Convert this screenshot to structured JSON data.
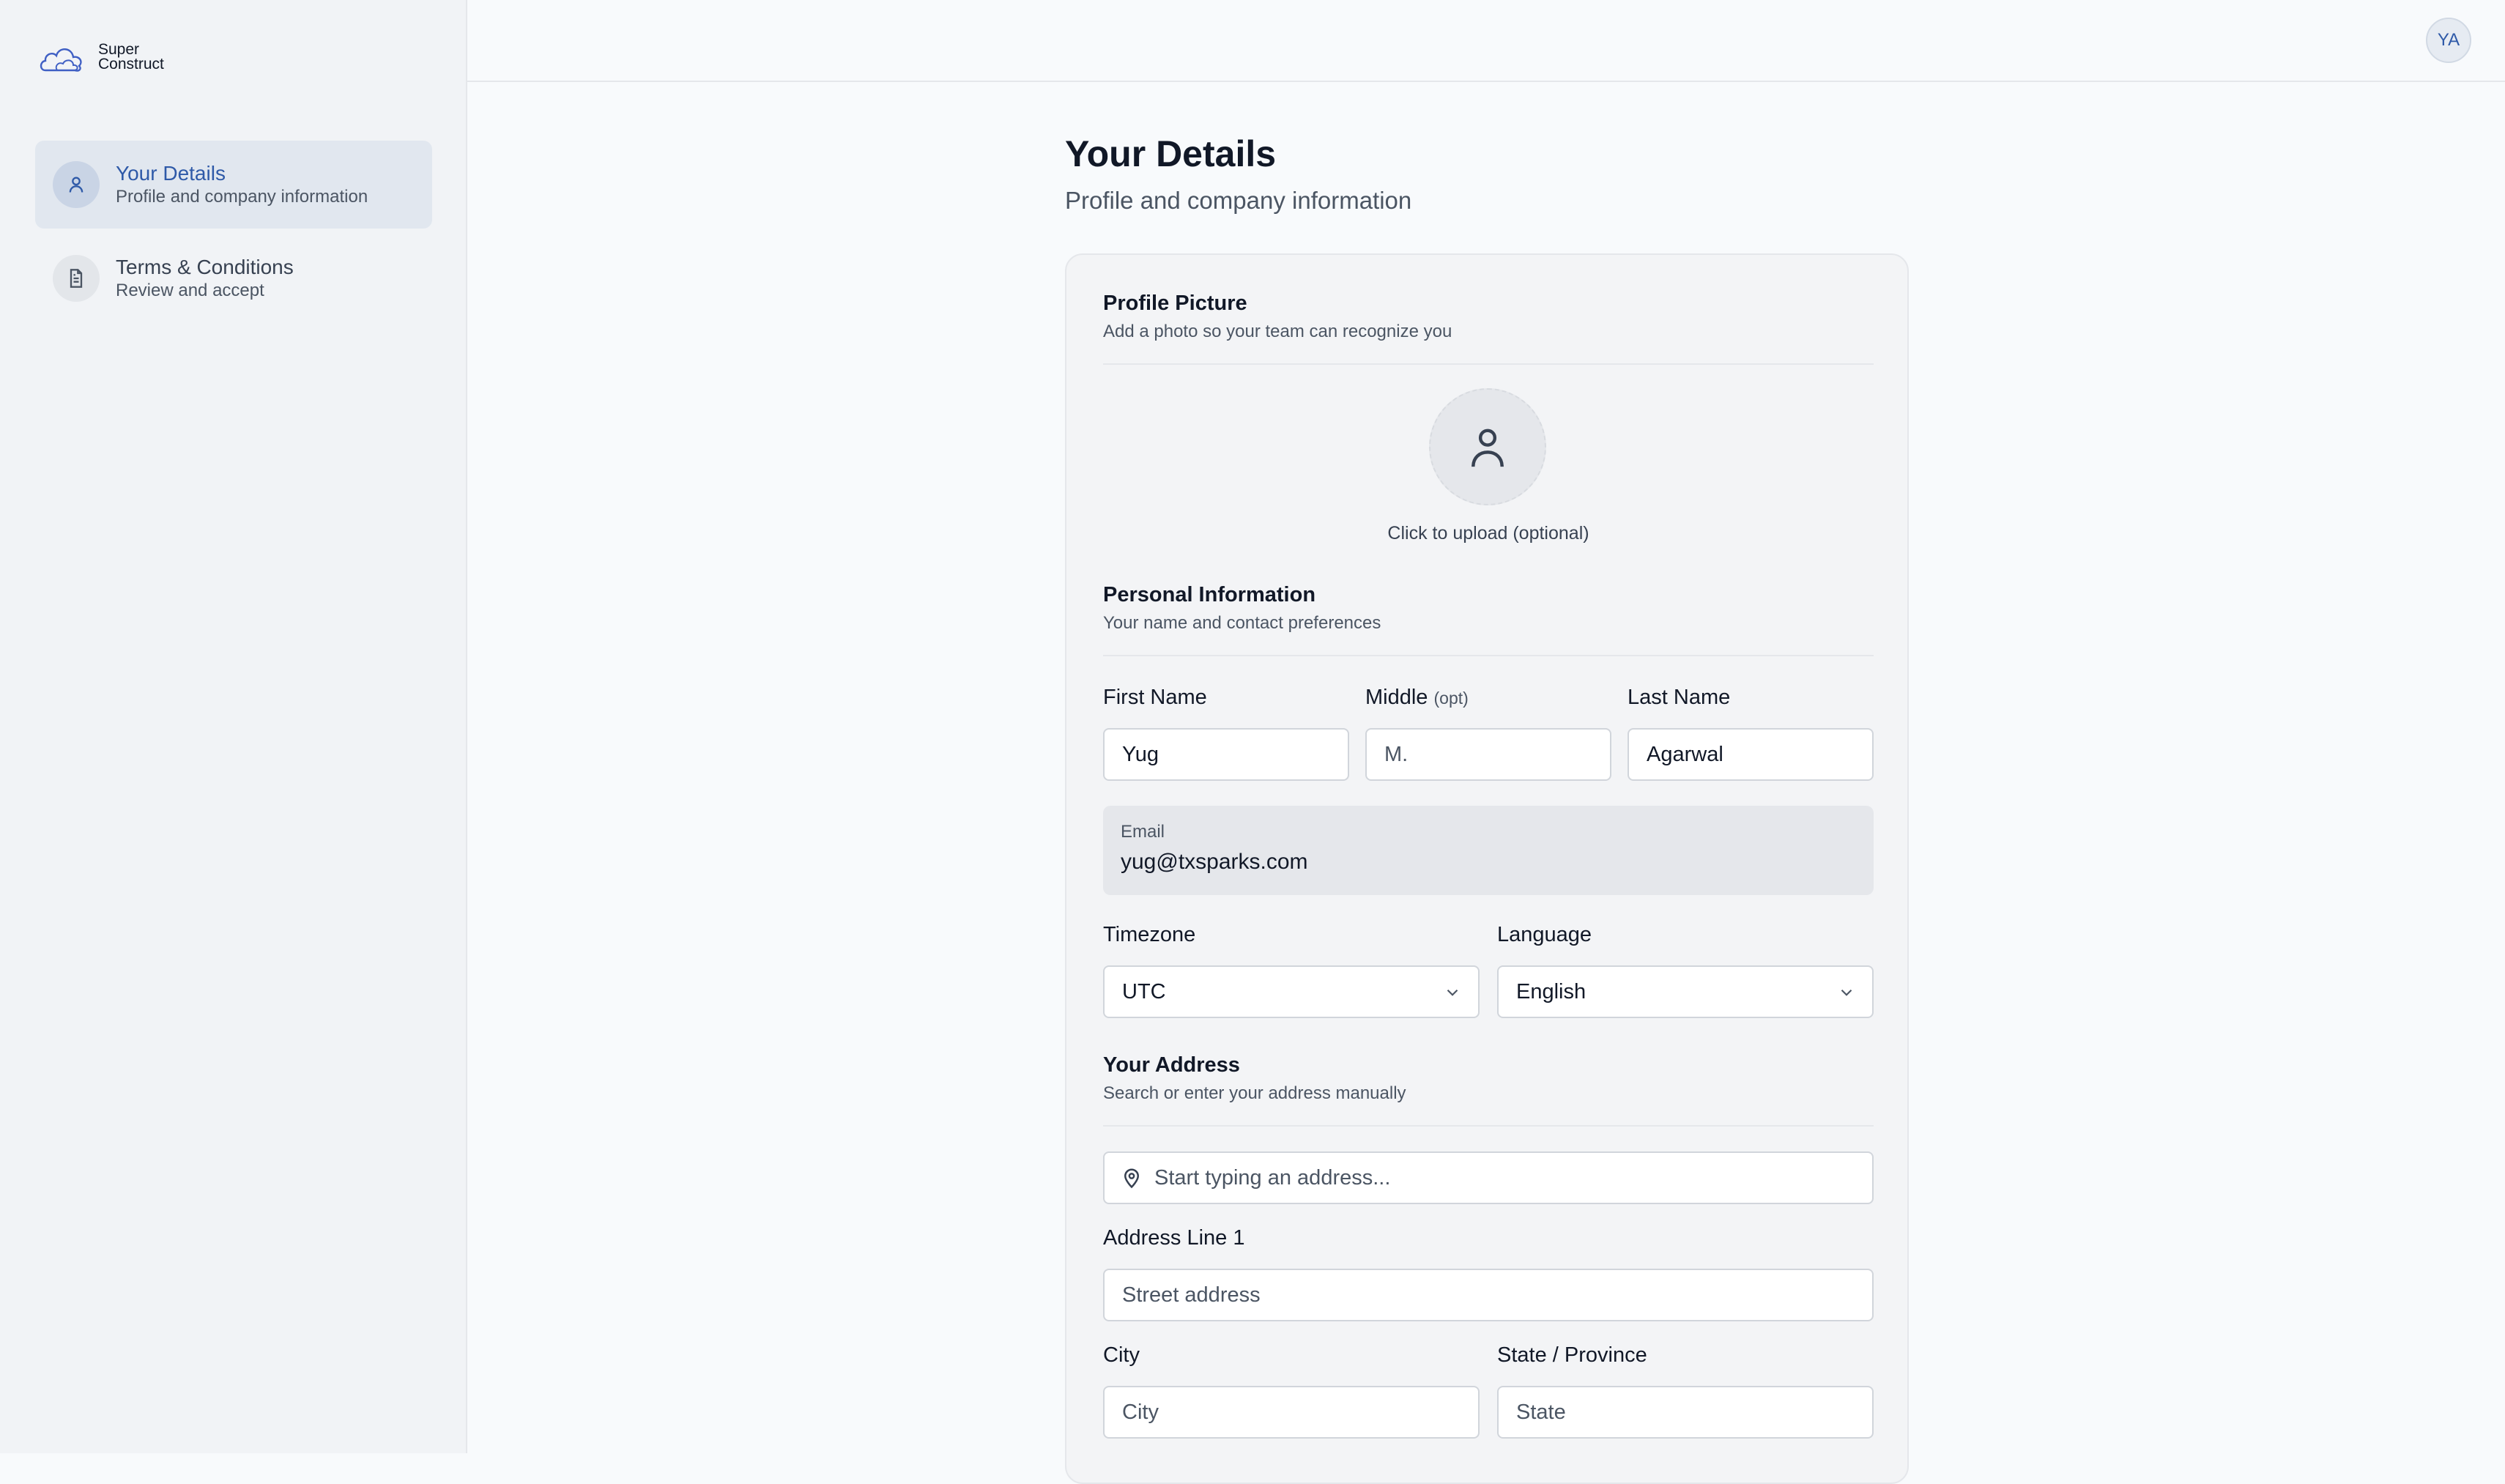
{
  "app": {
    "logo_line1": "Super",
    "logo_line2": "Construct"
  },
  "sidebar": {
    "items": [
      {
        "title": "Your Details",
        "subtitle": "Profile and company information",
        "icon": "user-icon",
        "active": true
      },
      {
        "title": "Terms & Conditions",
        "subtitle": "Review and accept",
        "icon": "document-icon",
        "active": false
      }
    ]
  },
  "header": {
    "avatar_initials": "YA"
  },
  "page": {
    "title": "Your Details",
    "subtitle": "Profile and company information"
  },
  "profile_picture": {
    "title": "Profile Picture",
    "subtitle": "Add a photo so your team can recognize you",
    "upload_label": "Click to upload (optional)"
  },
  "personal": {
    "title": "Personal Information",
    "subtitle": "Your name and contact preferences",
    "first_name_label": "First Name",
    "first_name_value": "Yug",
    "middle_label": "Middle",
    "middle_opt": "(opt)",
    "middle_placeholder": "M.",
    "last_name_label": "Last Name",
    "last_name_value": "Agarwal",
    "email_label": "Email",
    "email_value": "yug@txsparks.com",
    "timezone_label": "Timezone",
    "timezone_value": "UTC",
    "language_label": "Language",
    "language_value": "English"
  },
  "address": {
    "title": "Your Address",
    "subtitle": "Search or enter your address manually",
    "search_placeholder": "Start typing an address...",
    "line1_label": "Address Line 1",
    "line1_placeholder": "Street address",
    "city_label": "City",
    "city_placeholder": "City",
    "state_label": "State / Province",
    "state_placeholder": "State"
  },
  "colors": {
    "accent": "#2f5aa8",
    "sidebar_bg": "#f1f3f6",
    "page_bg": "#f8fafc"
  }
}
